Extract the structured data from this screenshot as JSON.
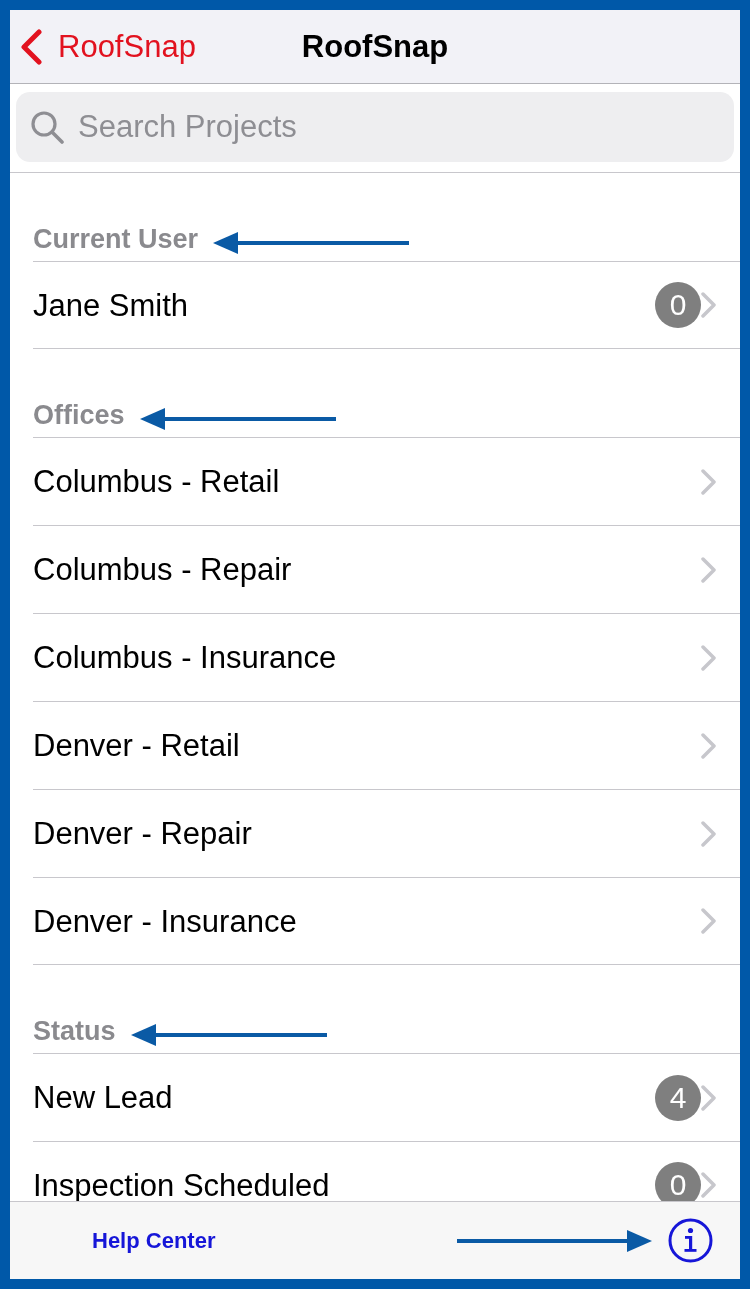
{
  "nav_bar": {
    "back_button": {
      "label": "RoofSnap"
    },
    "title": "RoofSnap"
  },
  "search": {
    "placeholder": "Search Projects"
  },
  "sections": [
    {
      "header": "Current User",
      "pointer_arrow": true,
      "rows": [
        {
          "label": "Jane Smith",
          "badge": "0"
        }
      ]
    },
    {
      "header": "Offices",
      "pointer_arrow": true,
      "rows": [
        {
          "label": "Columbus - Retail"
        },
        {
          "label": "Columbus - Repair"
        },
        {
          "label": "Columbus - Insurance"
        },
        {
          "label": "Denver - Retail"
        },
        {
          "label": "Denver - Repair"
        },
        {
          "label": "Denver - Insurance"
        }
      ]
    },
    {
      "header": "Status",
      "pointer_arrow": true,
      "rows": [
        {
          "label": "New Lead",
          "badge": "4"
        },
        {
          "label": "Inspection Scheduled",
          "badge": "0"
        }
      ]
    }
  ],
  "toolbar": {
    "help_link": "Help Center",
    "info_pointer_arrow": true
  }
}
